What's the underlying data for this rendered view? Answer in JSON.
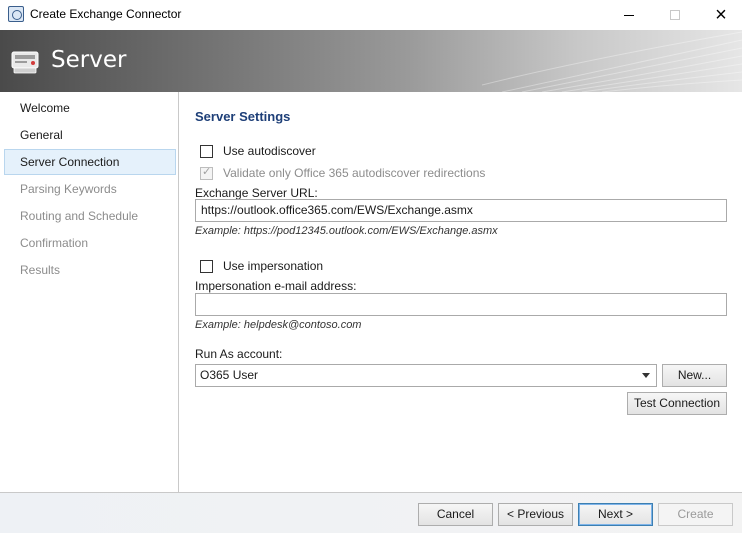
{
  "window": {
    "title": "Create Exchange Connector",
    "app_icon": "connector-app-icon",
    "controls": {
      "minimize": "minimize-icon",
      "maximize": "maximize-icon",
      "close": "×"
    }
  },
  "banner": {
    "title": "Server",
    "icon": "server-icon"
  },
  "nav": {
    "items": [
      {
        "label": "Welcome",
        "state": "normal"
      },
      {
        "label": "General",
        "state": "normal"
      },
      {
        "label": "Server Connection",
        "state": "selected"
      },
      {
        "label": "Parsing Keywords",
        "state": "disabled"
      },
      {
        "label": "Routing and Schedule",
        "state": "disabled"
      },
      {
        "label": "Confirmation",
        "state": "disabled"
      },
      {
        "label": "Results",
        "state": "disabled"
      }
    ]
  },
  "content": {
    "section_title": "Server Settings",
    "autodiscover": {
      "label": "Use autodiscover",
      "checked": false
    },
    "validate_o365": {
      "label": "Validate only Office 365 autodiscover redirections",
      "checked": true,
      "enabled": false
    },
    "server_url": {
      "label": "Exchange Server URL:",
      "value": "https://outlook.office365.com/EWS/Exchange.asmx",
      "example": "Example: https://pod12345.outlook.com/EWS/Exchange.asmx"
    },
    "impersonation": {
      "label": "Use impersonation",
      "checked": false
    },
    "impersonation_email": {
      "label": "Impersonation e-mail address:",
      "value": "",
      "example": "Example: helpdesk@contoso.com"
    },
    "run_as": {
      "label": "Run As account:",
      "selected": "O365 User",
      "new_button": "New...",
      "test_button": "Test Connection"
    }
  },
  "footer": {
    "cancel": "Cancel",
    "previous": "< Previous",
    "next": "Next >",
    "create": "Create"
  },
  "colors": {
    "section_title": "#1e3f78",
    "nav_selected_bg": "#e5f1fb",
    "nav_selected_border": "#b9d6ee",
    "disabled_text": "#8c8c8c"
  }
}
